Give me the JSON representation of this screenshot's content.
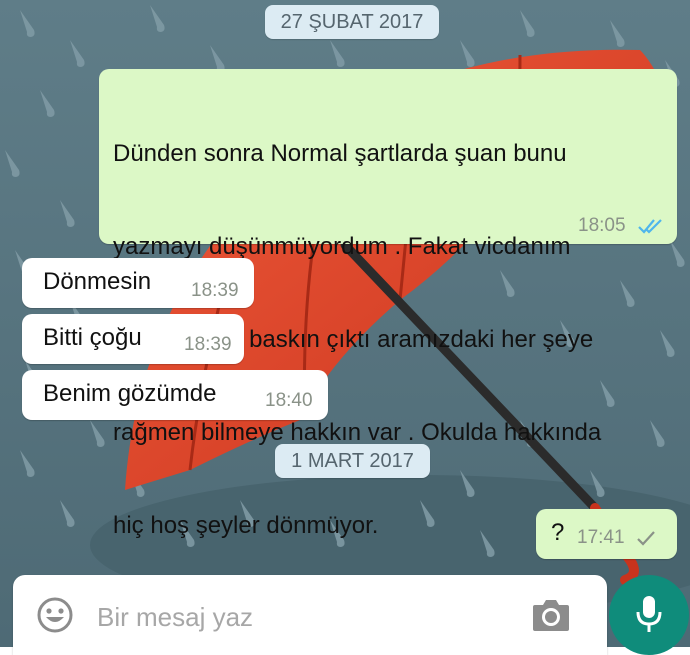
{
  "dates": {
    "first": "27 ŞUBAT 2017",
    "second": "1 MART 2017"
  },
  "messages": [
    {
      "direction": "outgoing",
      "lines": [
        "Dünden sonra Normal şartlarda şuan bunu",
        "yazmayı düşünmüyordum . Fakat vicdanım",
        "gururumdan baskın çıktı aramızdaki her şeye",
        "rağmen bilmeye hakkın var . Okulda hakkında",
        "hiç hoş şeyler dönmüyor."
      ],
      "time": "18:05",
      "status": "read"
    },
    {
      "direction": "incoming",
      "text": "Dönmesin",
      "time": "18:39"
    },
    {
      "direction": "incoming",
      "text": "Bitti çoğu",
      "time": "18:39"
    },
    {
      "direction": "incoming",
      "text": "Benim gözümde",
      "time": "18:40"
    },
    {
      "direction": "outgoing",
      "text": "?",
      "time": "17:41",
      "status": "sent"
    }
  ],
  "composer": {
    "placeholder": "Bir mesaj yaz",
    "emoji_icon": "emoji-icon",
    "camera_icon": "camera-icon",
    "mic_icon": "microphone-icon"
  },
  "colors": {
    "outgoing_bubble": "#dcf8c6",
    "incoming_bubble": "#ffffff",
    "read_ticks": "#4fb6ec",
    "mic_button": "#0f8c7b",
    "background": "#5d7a85",
    "umbrella": "#e0462a"
  }
}
